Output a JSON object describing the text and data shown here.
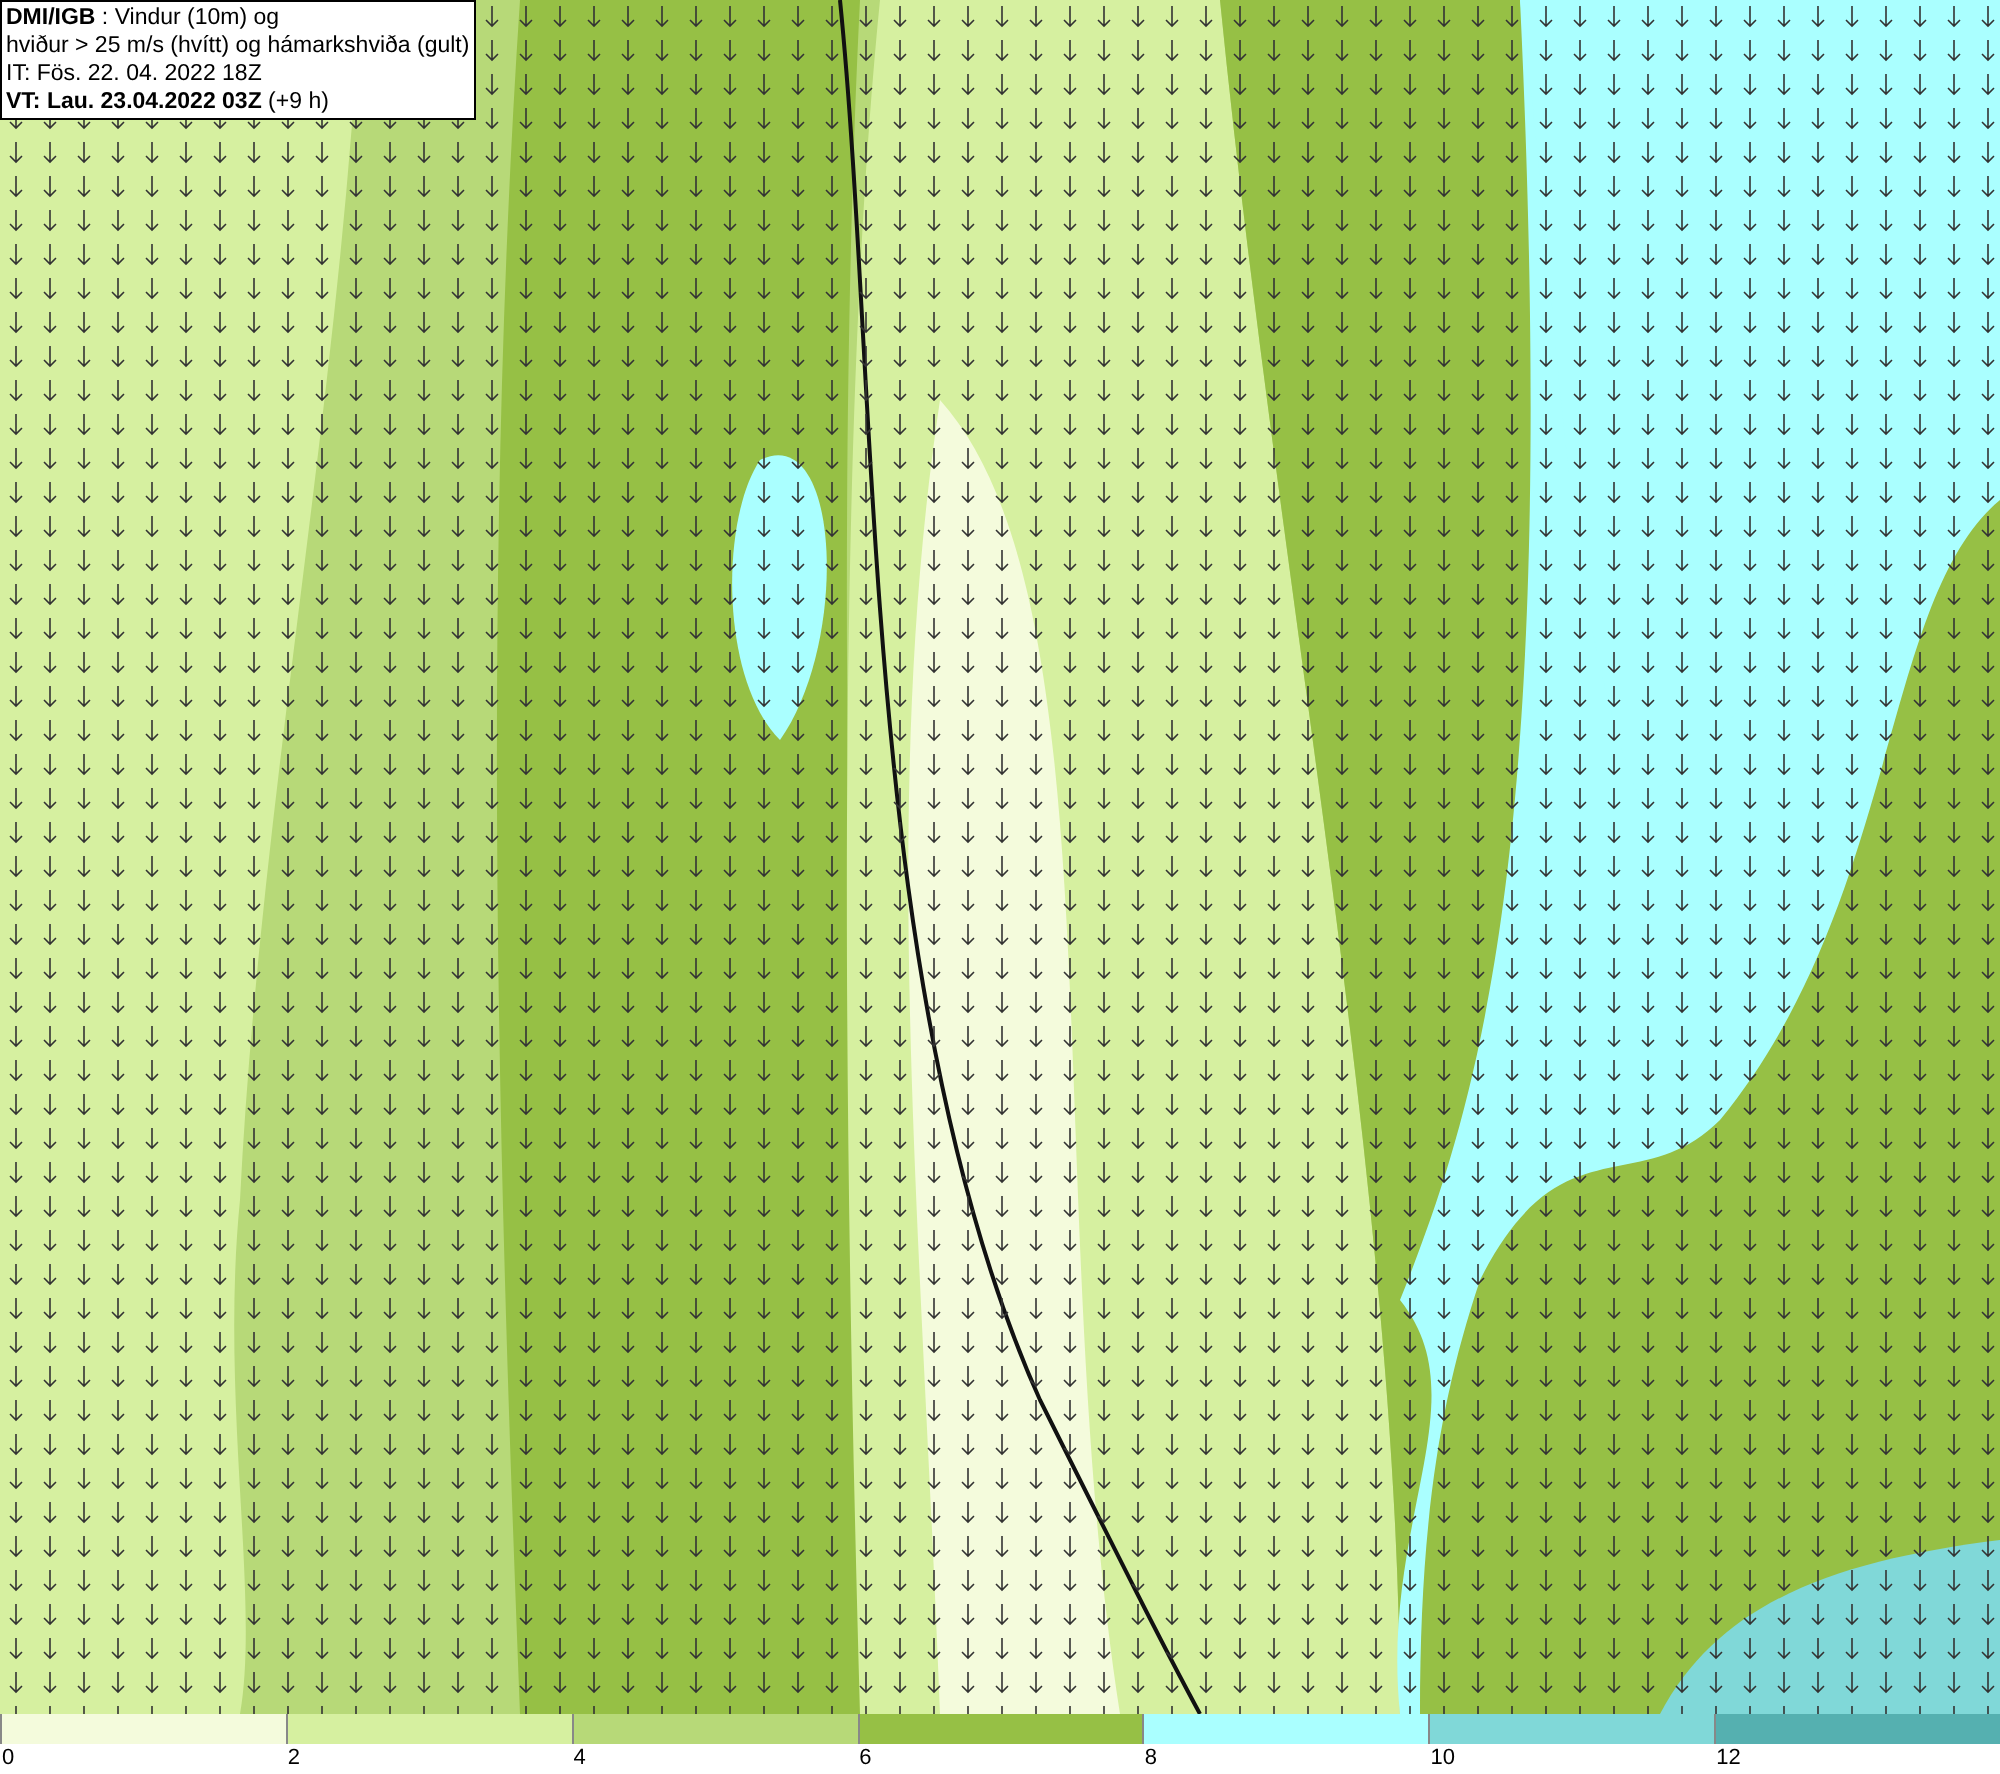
{
  "title_box": {
    "lines": [
      "**DMI/IGB** : Vindur (10m) og",
      "hviður > 25 m/s (hvítt) og hámarkshviða (gult)",
      "IT: Fös. 22. 04. 2022 18Z",
      "**VT: Lau. 23.04.2022 03Z** (+9 h)"
    ]
  },
  "legend": {
    "bins": [
      {
        "label": "0",
        "color": "#f4fbdc"
      },
      {
        "label": "2",
        "color": "#d6f0a0"
      },
      {
        "label": "4",
        "color": "#b7d978"
      },
      {
        "label": "6",
        "color": "#96c045"
      },
      {
        "label": "8",
        "color": "#aaffff"
      },
      {
        "label": "10",
        "color": "#80d8d8"
      },
      {
        "label": "12",
        "color": "#55b0b0"
      }
    ]
  }
}
